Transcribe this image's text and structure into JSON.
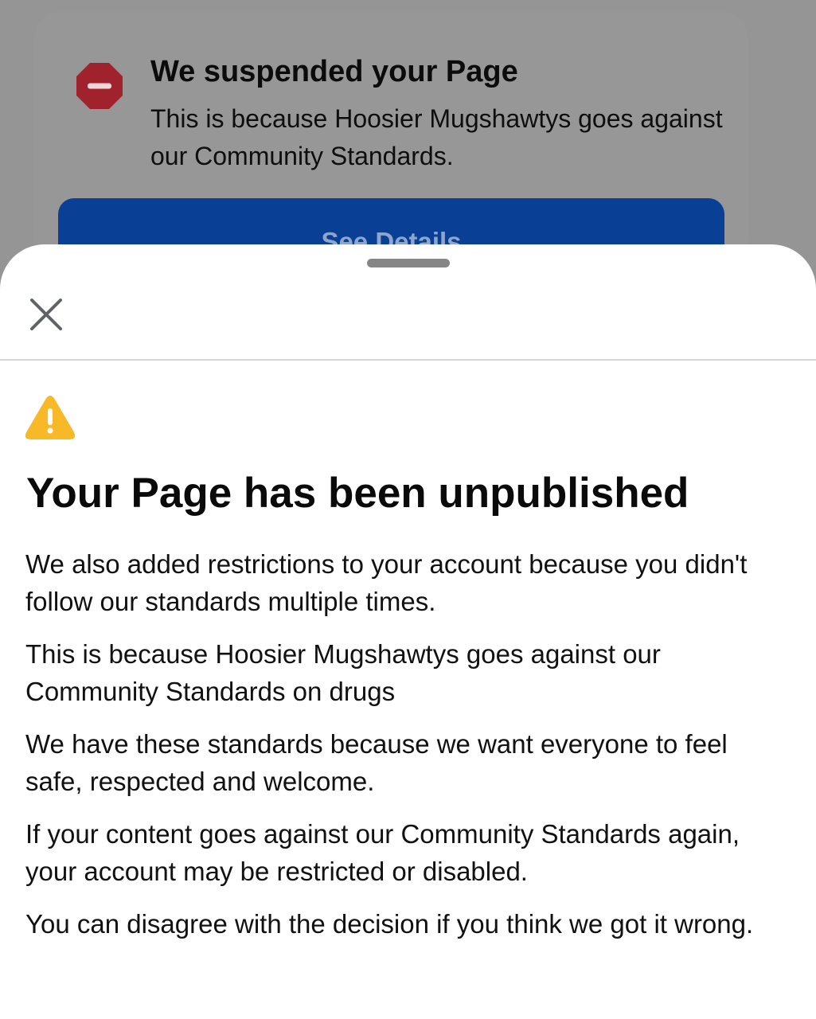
{
  "background_card": {
    "icon": "stop-icon",
    "title": "We suspended your Page",
    "description": "This is because Hoosier Mugshawtys goes against our Community Standards.",
    "button_label": "See Details"
  },
  "sheet": {
    "close_icon": "close-icon",
    "warning_icon": "warning-icon",
    "title": "Your Page has been unpublished",
    "paragraphs": [
      "We also added restrictions to your account because you didn't follow our standards multiple times.",
      "This is because Hoosier Mugshawtys goes against our Community Standards on drugs",
      "We have these standards because we want everyone to feel safe, respected and welcome.",
      "If your content goes against our Community Standards again, your account may be restricted or disabled.",
      "You can disagree with the decision if you think we got it wrong."
    ]
  },
  "colors": {
    "overlay": "#959595",
    "stop_red": "#a0222c",
    "button_blue": "#0a3f96",
    "warning_yellow": "#f7b928",
    "sheet_bg": "#ffffff"
  }
}
